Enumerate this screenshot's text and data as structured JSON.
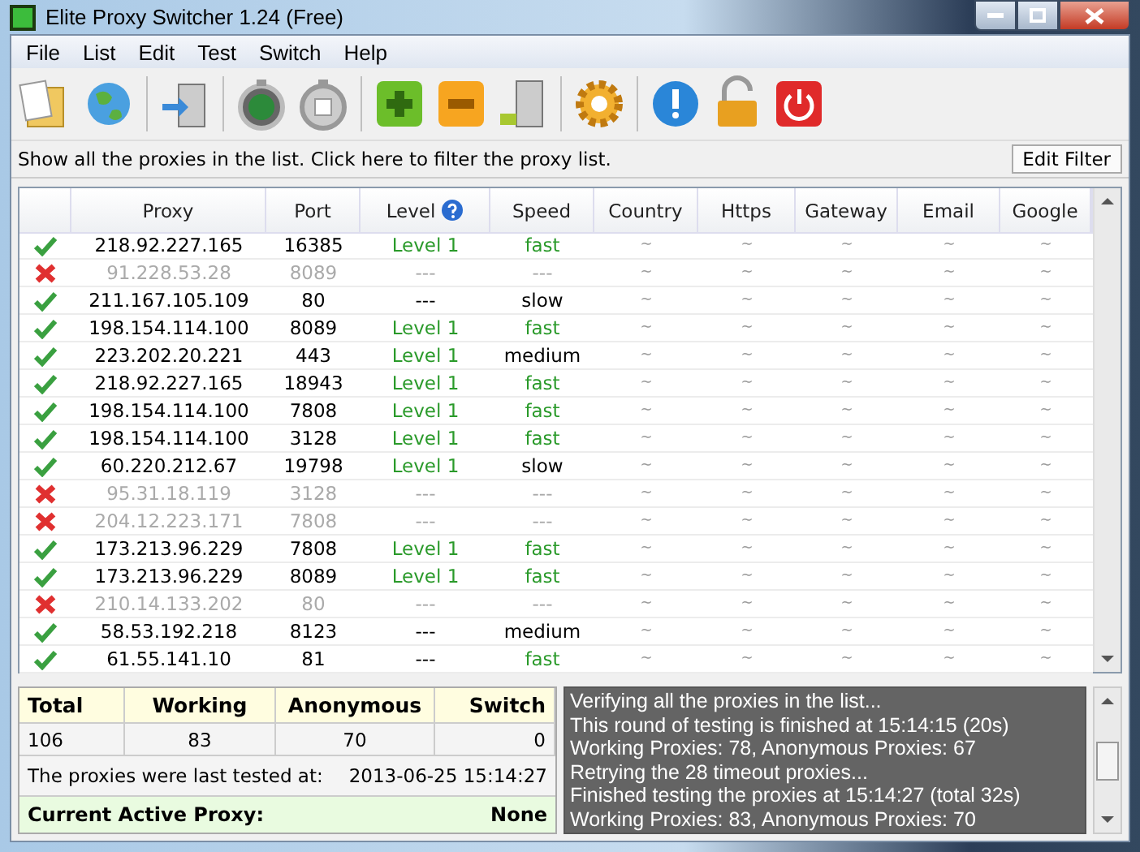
{
  "window": {
    "title": "Elite Proxy Switcher 1.24 (Free)"
  },
  "menu": [
    "File",
    "List",
    "Edit",
    "Test",
    "Switch",
    "Help"
  ],
  "filter": {
    "text": "Show all the proxies in the list. Click here to filter the proxy list.",
    "button": "Edit Filter"
  },
  "table": {
    "columns": [
      "Proxy",
      "Port",
      "Level",
      "Speed",
      "Country",
      "Https",
      "Gateway",
      "Email",
      "Google"
    ],
    "rows": [
      {
        "working": true,
        "proxy": "218.92.227.165",
        "port": "16385",
        "level": {
          "text": "Level 1",
          "good": true
        },
        "speed": {
          "text": "fast",
          "good": true
        },
        "checks": [
          "~",
          "~",
          "~",
          "~",
          "~"
        ]
      },
      {
        "working": false,
        "proxy": "91.228.53.28",
        "port": "8089",
        "level": {
          "text": "---"
        },
        "speed": {
          "text": "---"
        },
        "checks": [
          "~",
          "~",
          "~",
          "~",
          "~"
        ]
      },
      {
        "working": true,
        "proxy": "211.167.105.109",
        "port": "80",
        "level": {
          "text": "---",
          "good": false
        },
        "speed": {
          "text": "slow",
          "good": false
        },
        "checks": [
          "~",
          "~",
          "~",
          "~",
          "~"
        ]
      },
      {
        "working": true,
        "proxy": "198.154.114.100",
        "port": "8089",
        "level": {
          "text": "Level 1",
          "good": true
        },
        "speed": {
          "text": "fast",
          "good": true
        },
        "checks": [
          "~",
          "~",
          "~",
          "~",
          "~"
        ]
      },
      {
        "working": true,
        "proxy": "223.202.20.221",
        "port": "443",
        "level": {
          "text": "Level 1",
          "good": true
        },
        "speed": {
          "text": "medium",
          "good": false
        },
        "checks": [
          "~",
          "~",
          "~",
          "~",
          "~"
        ]
      },
      {
        "working": true,
        "proxy": "218.92.227.165",
        "port": "18943",
        "level": {
          "text": "Level 1",
          "good": true
        },
        "speed": {
          "text": "fast",
          "good": true
        },
        "checks": [
          "~",
          "~",
          "~",
          "~",
          "~"
        ]
      },
      {
        "working": true,
        "proxy": "198.154.114.100",
        "port": "7808",
        "level": {
          "text": "Level 1",
          "good": true
        },
        "speed": {
          "text": "fast",
          "good": true
        },
        "checks": [
          "~",
          "~",
          "~",
          "~",
          "~"
        ]
      },
      {
        "working": true,
        "proxy": "198.154.114.100",
        "port": "3128",
        "level": {
          "text": "Level 1",
          "good": true
        },
        "speed": {
          "text": "fast",
          "good": true
        },
        "checks": [
          "~",
          "~",
          "~",
          "~",
          "~"
        ]
      },
      {
        "working": true,
        "proxy": "60.220.212.67",
        "port": "19798",
        "level": {
          "text": "Level 1",
          "good": true
        },
        "speed": {
          "text": "slow",
          "good": false
        },
        "checks": [
          "~",
          "~",
          "~",
          "~",
          "~"
        ]
      },
      {
        "working": false,
        "proxy": "95.31.18.119",
        "port": "3128",
        "level": {
          "text": "---"
        },
        "speed": {
          "text": "---"
        },
        "checks": [
          "~",
          "~",
          "~",
          "~",
          "~"
        ]
      },
      {
        "working": false,
        "proxy": "204.12.223.171",
        "port": "7808",
        "level": {
          "text": "---"
        },
        "speed": {
          "text": "---"
        },
        "checks": [
          "~",
          "~",
          "~",
          "~",
          "~"
        ]
      },
      {
        "working": true,
        "proxy": "173.213.96.229",
        "port": "7808",
        "level": {
          "text": "Level 1",
          "good": true
        },
        "speed": {
          "text": "fast",
          "good": true
        },
        "checks": [
          "~",
          "~",
          "~",
          "~",
          "~"
        ]
      },
      {
        "working": true,
        "proxy": "173.213.96.229",
        "port": "8089",
        "level": {
          "text": "Level 1",
          "good": true
        },
        "speed": {
          "text": "fast",
          "good": true
        },
        "checks": [
          "~",
          "~",
          "~",
          "~",
          "~"
        ]
      },
      {
        "working": false,
        "proxy": "210.14.133.202",
        "port": "80",
        "level": {
          "text": "---"
        },
        "speed": {
          "text": "---"
        },
        "checks": [
          "~",
          "~",
          "~",
          "~",
          "~"
        ]
      },
      {
        "working": true,
        "proxy": "58.53.192.218",
        "port": "8123",
        "level": {
          "text": "---",
          "good": false
        },
        "speed": {
          "text": "medium",
          "good": false
        },
        "checks": [
          "~",
          "~",
          "~",
          "~",
          "~"
        ]
      },
      {
        "working": true,
        "proxy": "61.55.141.10",
        "port": "81",
        "level": {
          "text": "---",
          "good": false
        },
        "speed": {
          "text": "fast",
          "good": true
        },
        "checks": [
          "~",
          "~",
          "~",
          "~",
          "~"
        ]
      }
    ]
  },
  "stats": {
    "headers": [
      "Total",
      "Working",
      "Anonymous",
      "Switch"
    ],
    "values": [
      "106",
      "83",
      "70",
      "0"
    ],
    "tested_label": "The proxies were last tested at:",
    "tested_value": "2013-06-25 15:14:27",
    "active_label": "Current Active Proxy:",
    "active_value": "None"
  },
  "log": [
    "Verifying all the proxies in the list...",
    "This round of testing is finished at 15:14:15 (20s)",
    "Working Proxies: 78, Anonymous Proxies: 67",
    "Retrying the 28 timeout proxies...",
    "Finished testing the proxies at 15:14:27 (total 32s)",
    "Working Proxies: 83, Anonymous Proxies: 70"
  ]
}
